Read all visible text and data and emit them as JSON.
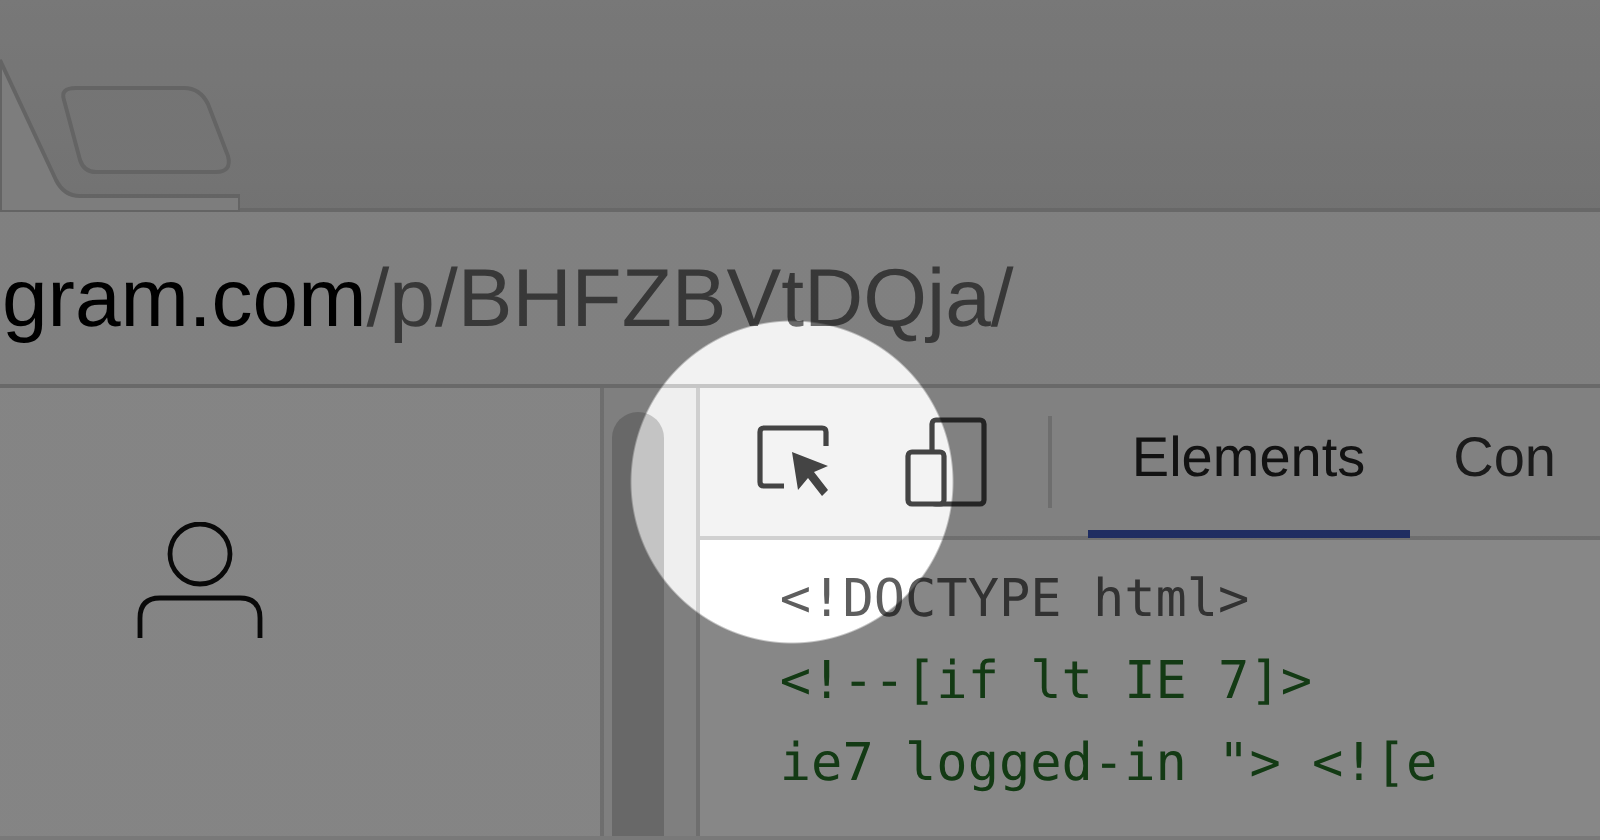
{
  "address_bar": {
    "url_host": "gram.com",
    "url_path": "/p/BHFZBVtDQja/"
  },
  "devtools": {
    "tabs": [
      {
        "label": "Elements",
        "selected": true
      },
      {
        "label": "Con",
        "selected": false
      }
    ],
    "code_lines": [
      {
        "text": "<!DOCTYPE html>",
        "kind": "doctype"
      },
      {
        "text": "<!--[if lt IE 7]>",
        "kind": "comment"
      },
      {
        "text": "ie7 logged-in \"> <![e",
        "kind": "comment"
      }
    ]
  }
}
